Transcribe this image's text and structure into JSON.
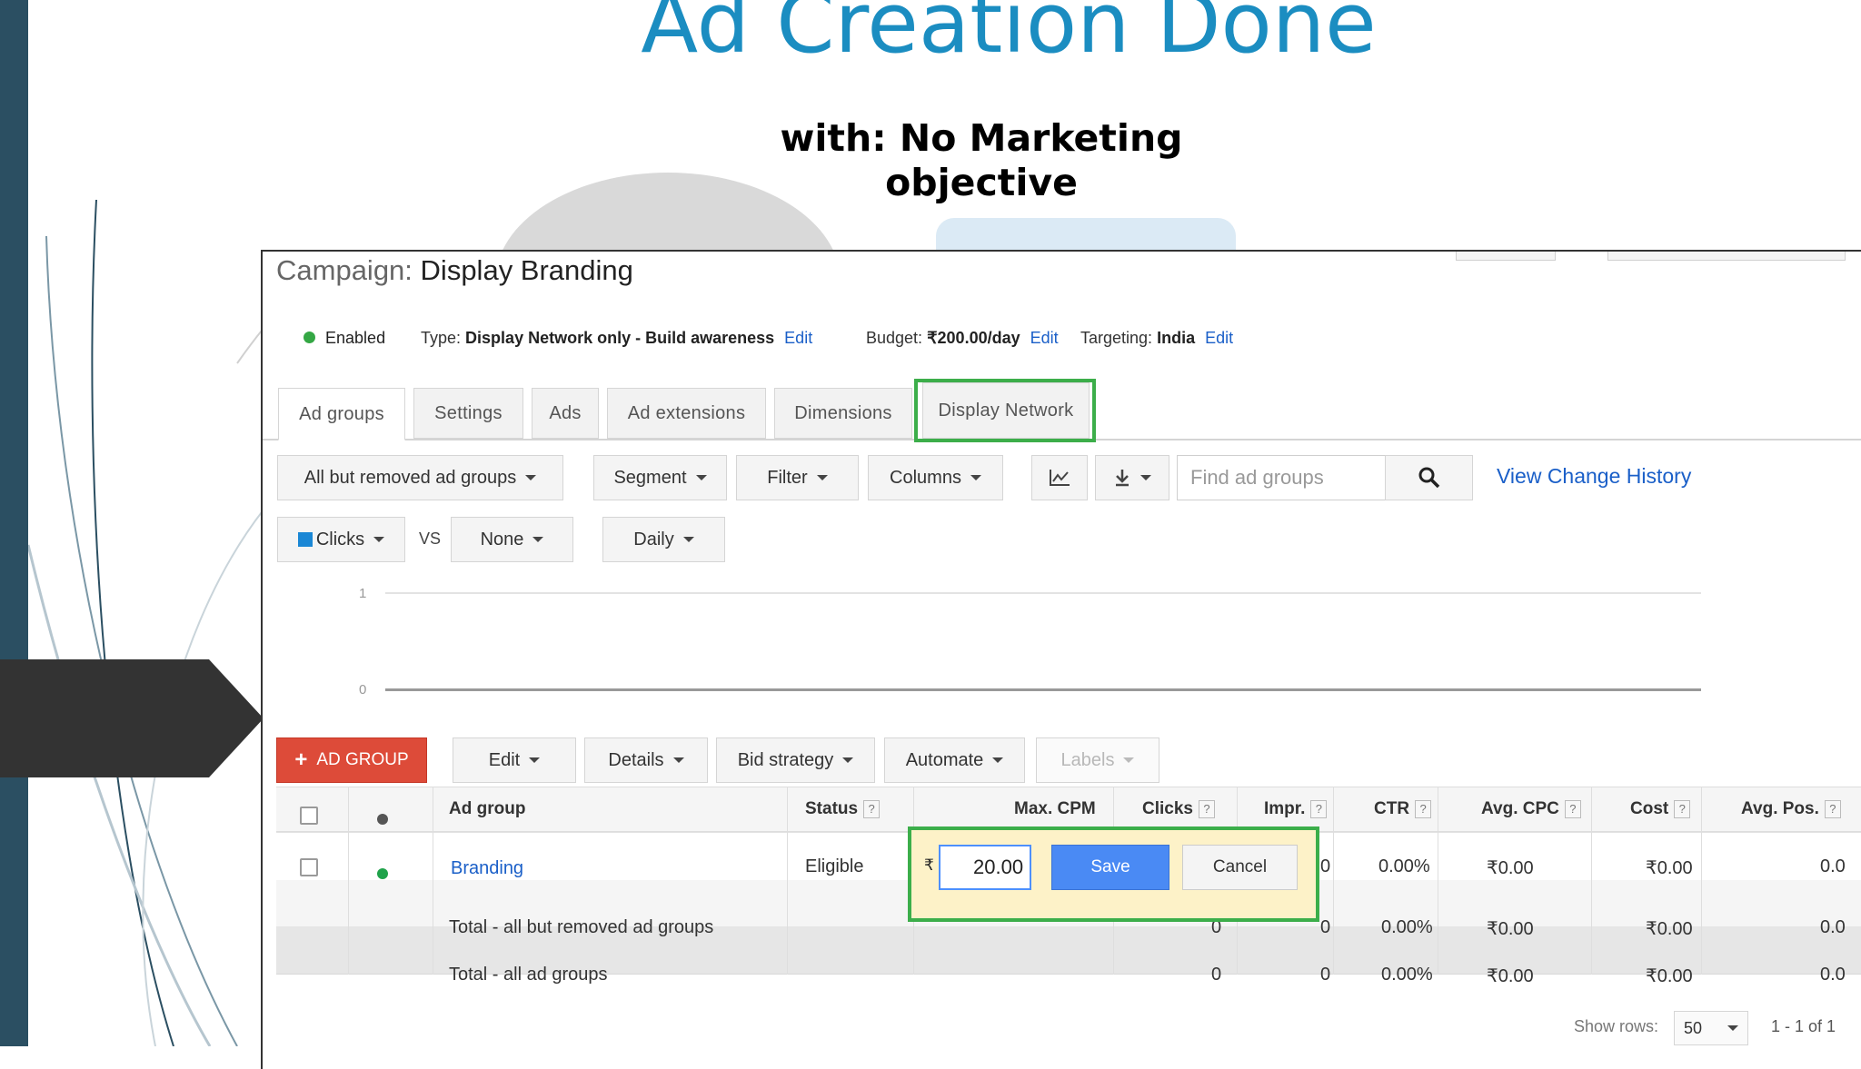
{
  "slide": {
    "title": "Ad Creation Done",
    "subtitle_line1": "with: No Marketing",
    "subtitle_line2": "objective"
  },
  "campaign": {
    "label": "Campaign:",
    "name": "Display Branding",
    "status": "Enabled",
    "type_key": "Type:",
    "type_value": "Display Network only - Build awareness",
    "budget_key": "Budget:",
    "budget_value": "₹200.00/day",
    "targeting_key": "Targeting:",
    "targeting_value": "India",
    "edit_link": "Edit"
  },
  "tabs": [
    {
      "label": "Ad groups",
      "active": true
    },
    {
      "label": "Settings"
    },
    {
      "label": "Ads"
    },
    {
      "label": "Ad extensions"
    },
    {
      "label": "Dimensions"
    },
    {
      "label": "Display Network",
      "highlighted": true
    }
  ],
  "toolbar": {
    "filter_scope": "All but removed ad groups",
    "segment": "Segment",
    "filter": "Filter",
    "columns": "Columns",
    "search_placeholder": "Find ad groups",
    "view_change_history": "View Change History"
  },
  "chart_controls": {
    "metric1": "Clicks",
    "vs": "VS",
    "metric2": "None",
    "period": "Daily",
    "metric1_color": "#1a87d5"
  },
  "chart_data": {
    "type": "line",
    "ytick_top": "1",
    "ytick_bottom": "0",
    "ylim": [
      0,
      1
    ],
    "series": [
      {
        "name": "Clicks",
        "values": []
      }
    ]
  },
  "actions": {
    "add_ad_group": "AD GROUP",
    "edit": "Edit",
    "details": "Details",
    "bid_strategy": "Bid strategy",
    "automate": "Automate",
    "labels": "Labels"
  },
  "table": {
    "headers": {
      "ad_group": "Ad group",
      "status": "Status",
      "max_cpm": "Max. CPM",
      "clicks": "Clicks",
      "impr": "Impr.",
      "ctr": "CTR",
      "avg_cpc": "Avg. CPC",
      "cost": "Cost",
      "avg_pos": "Avg. Pos.",
      "help": "?"
    },
    "row": {
      "name": "Branding",
      "status": "Eligible",
      "impr": "0",
      "ctr": "0.00%",
      "avg_cpc": "₹0.00",
      "cost": "₹0.00",
      "avg_pos": "0.0"
    },
    "total_removed": {
      "label": "Total - all but removed ad groups",
      "clicks": "0",
      "impr": "0",
      "ctr": "0.00%",
      "avg_cpc": "₹0.00",
      "cost": "₹0.00",
      "avg_pos": "0.0"
    },
    "total_all": {
      "label": "Total - all ad groups",
      "clicks": "0",
      "impr": "0",
      "ctr": "0.00%",
      "avg_cpc": "₹0.00",
      "cost": "₹0.00",
      "avg_pos": "0.0"
    }
  },
  "bid_editor": {
    "currency": "₹",
    "value": "20.00",
    "save": "Save",
    "cancel": "Cancel"
  },
  "pagination": {
    "show_rows_label": "Show rows:",
    "rows_value": "50",
    "range": "1 - 1 of 1"
  },
  "colors": {
    "accent_title": "#1b8dc1",
    "highlight_green": "#3cae4a",
    "add_button": "#dd4b39",
    "save_button": "#4a8af4",
    "link": "#1a5fc8"
  }
}
